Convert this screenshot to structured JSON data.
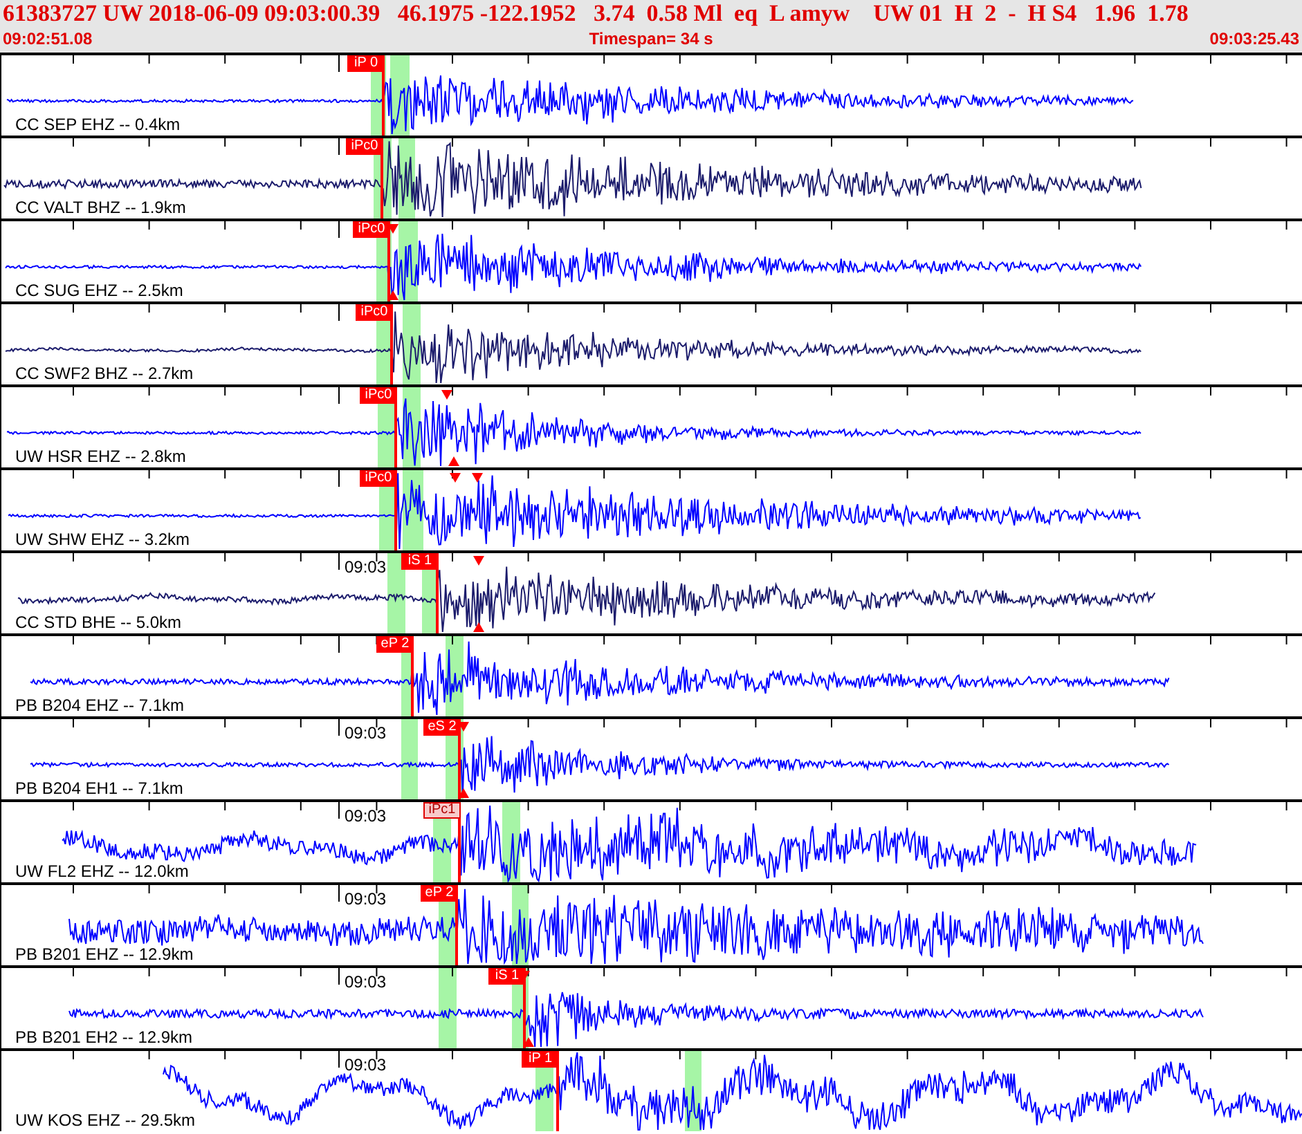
{
  "header": {
    "event_line": "61383727 UW 2018-06-09 09:03:00.39   46.1975 -122.1952   3.74  0.58 Ml  eq  L amyw    UW 01  H  2  -  H S4   1.96  1.78",
    "start_time": "09:02:51.08",
    "timespan": "Timespan=  34 s",
    "end_time": "09:03:25.43"
  },
  "traces": [
    {
      "label": "CC SEP EHZ -- 0.4km",
      "color": "#0000ff",
      "pick": {
        "label": "iP 0",
        "kind": "solid"
      }
    },
    {
      "label": "CC VALT BHZ -- 1.9km",
      "color": "#1c1c6c",
      "pick": {
        "label": "iPc0",
        "kind": "solid"
      }
    },
    {
      "label": "CC SUG EHZ -- 2.5km",
      "color": "#0000ff",
      "pick": {
        "label": "iPc0",
        "kind": "solid"
      }
    },
    {
      "label": "CC SWF2 BHZ -- 2.7km",
      "color": "#1c1c6c",
      "pick": {
        "label": "iPc0",
        "kind": "solid"
      }
    },
    {
      "label": "UW HSR EHZ -- 2.8km",
      "color": "#0000ff",
      "pick": {
        "label": "iPc0",
        "kind": "solid"
      }
    },
    {
      "label": "UW SHW EHZ -- 3.2km",
      "color": "#0000ff",
      "pick": {
        "label": "iPc0",
        "kind": "solid"
      }
    },
    {
      "label": "CC STD BHE -- 5.0km",
      "color": "#1c1c6c",
      "time_label": "09:03",
      "pick": {
        "label": "iS 1",
        "kind": "solid"
      }
    },
    {
      "label": "PB B204 EHZ -- 7.1km",
      "color": "#0000ff",
      "pick": {
        "label": "eP 2",
        "kind": "solid"
      }
    },
    {
      "label": "PB B204 EH1 -- 7.1km",
      "color": "#0000ff",
      "time_label": "09:03",
      "pick": {
        "label": "eS 2",
        "kind": "solid"
      }
    },
    {
      "label": "UW FL2 EHZ -- 12.0km",
      "color": "#0000ff",
      "time_label": "09:03",
      "pick": {
        "label": "iPc1",
        "kind": "outline"
      }
    },
    {
      "label": "PB B201 EHZ -- 12.9km",
      "color": "#0000ff",
      "time_label": "09:03",
      "pick": {
        "label": "eP 2",
        "kind": "solid"
      }
    },
    {
      "label": "PB B201 EH2 -- 12.9km",
      "color": "#0000ff",
      "time_label": "09:03",
      "pick": {
        "label": "iS 1",
        "kind": "solid"
      }
    },
    {
      "label": "UW KOS EHZ -- 29.5km",
      "color": "#0000ff",
      "time_label": "09:03",
      "pick": {
        "label": "iP 1",
        "kind": "solid"
      }
    }
  ]
}
